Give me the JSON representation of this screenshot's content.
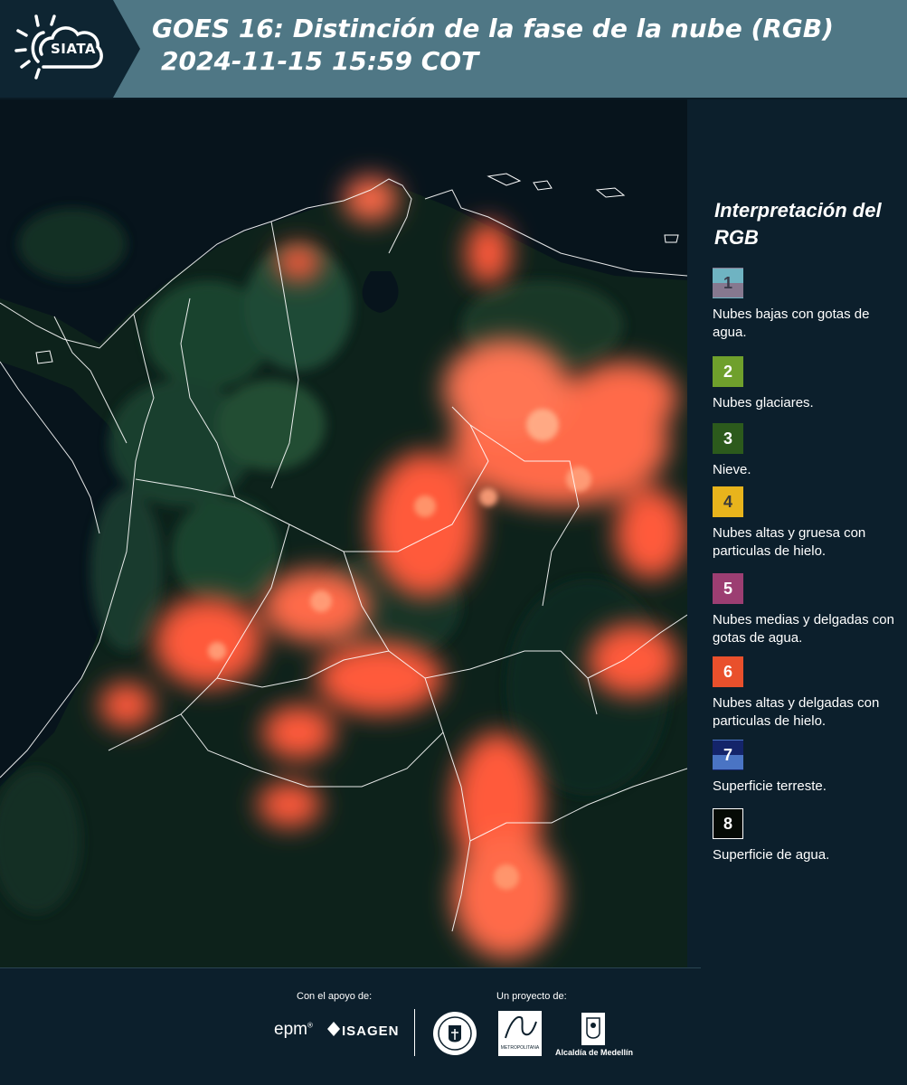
{
  "header": {
    "logo_text": "SIATA",
    "title_line1": "GOES 16: Distinción de la fase de la nube (RGB)",
    "title_line2": "2024-11-15 15:59 COT"
  },
  "map": {
    "icon": "satellite-rgb-image",
    "colors": {
      "ocean": "#07141c",
      "land": "#0f2a20",
      "vegetation": "#1f4a32",
      "cloud_ice": "#ff5a3a",
      "borders": "#ffffff"
    }
  },
  "legend": {
    "title": "Interpretación del RGB",
    "items": [
      {
        "number": "1",
        "label": "Nubes bajas con gotas de agua.",
        "color_top": "#6fb3c2",
        "color_bottom": "#86788f",
        "num_color": "#3a3a4a"
      },
      {
        "number": "2",
        "label": "Nubes glaciares.",
        "color_top": "#6fa02c",
        "color_bottom": "#6fa02c",
        "num_color": "#ffffff"
      },
      {
        "number": "3",
        "label": "Nieve.",
        "color_top": "#2c5a1c",
        "color_bottom": "#2c5a1c",
        "num_color": "#ffffff"
      },
      {
        "number": "4",
        "label": "Nubes altas y gruesa con particulas de hielo.",
        "color_top": "#e8b41c",
        "color_bottom": "#e8b41c",
        "num_color": "#3a3a3a"
      },
      {
        "number": "5",
        "label": "Nubes medias y delgadas con gotas de agua.",
        "color_top": "#9c3e72",
        "color_bottom": "#9c3e72",
        "num_color": "#ffffff"
      },
      {
        "number": "6",
        "label": "Nubes altas y delgadas con particulas de hielo.",
        "color_top": "#e9502c",
        "color_bottom": "#e9502c",
        "num_color": "#ffffff"
      },
      {
        "number": "7",
        "label": "Superficie terreste.",
        "color_top": "#14246a",
        "color_bottom": "#4a74c4",
        "num_color": "#ffffff"
      },
      {
        "number": "8",
        "label": "Superficie de agua.",
        "color_top": "#050a05",
        "color_bottom": "#050a05",
        "num_color": "#ffffff"
      }
    ]
  },
  "footer": {
    "support_label": "Con el apoyo de:",
    "project_label": "Un proyecto de:",
    "epm": "epm",
    "isagen": "ISAGEN",
    "area_text": "METROPOLITANA",
    "alcaldia": "Alcaldía de Medellín"
  }
}
